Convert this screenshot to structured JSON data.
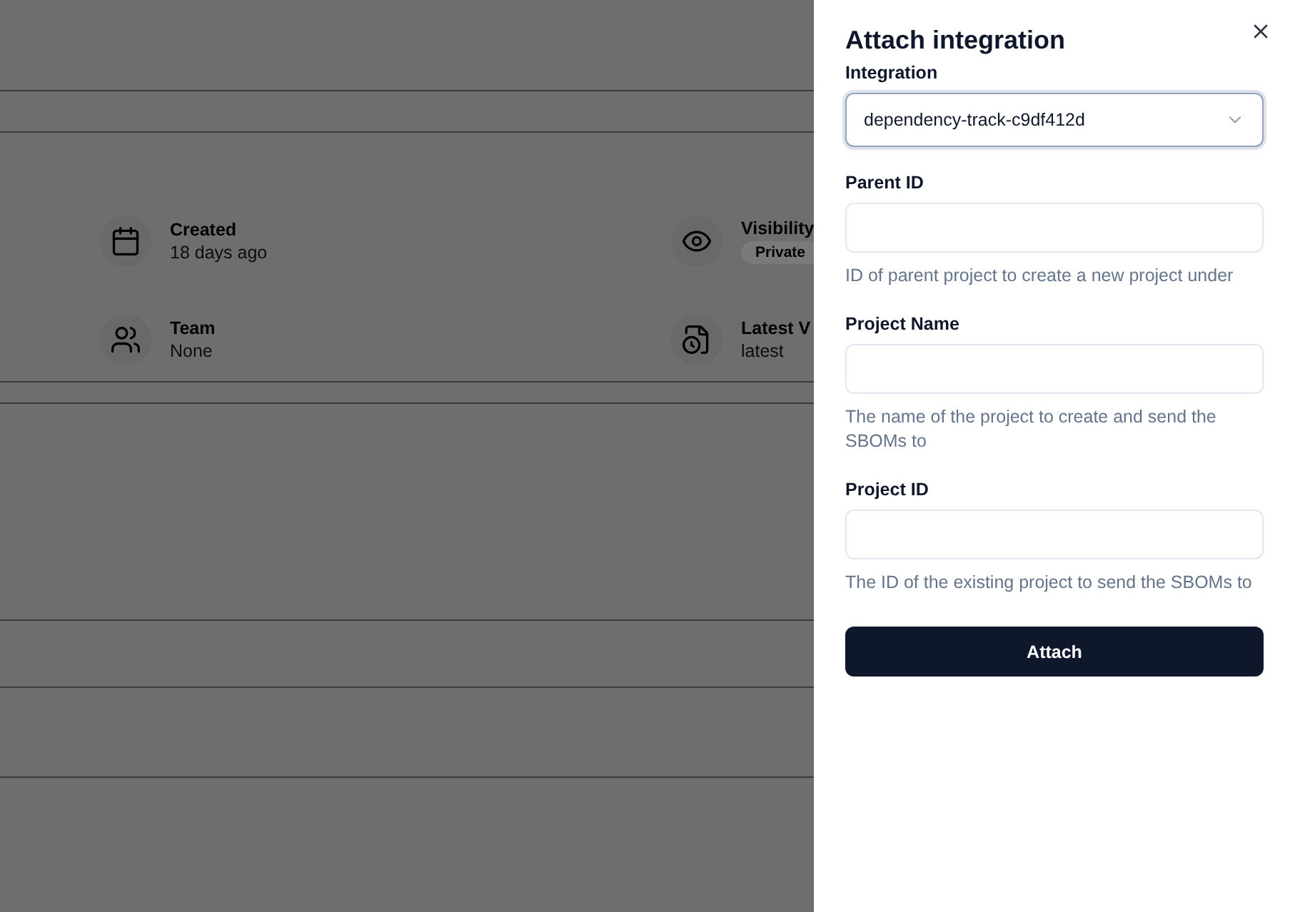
{
  "background": {
    "details": [
      {
        "label": "Created",
        "value": "18 days ago",
        "kind": "text"
      },
      {
        "label": "Visibility",
        "value": "Private",
        "kind": "badge"
      },
      {
        "label": "Team",
        "value": "None",
        "kind": "text"
      },
      {
        "label": "Latest V",
        "value": "latest",
        "kind": "text"
      }
    ]
  },
  "sheet": {
    "title": "Attach integration",
    "fields": [
      {
        "kind": "select",
        "label": "Integration",
        "value": "dependency-track-c9df412d",
        "focused": true
      },
      {
        "kind": "input",
        "label": "Parent ID",
        "help": "ID of parent project to create a new project under"
      },
      {
        "kind": "input",
        "label": "Project Name",
        "help": "The name of the project to create and send the SBOMs to"
      },
      {
        "kind": "input",
        "label": "Project ID",
        "help": "The ID of the existing project to send the SBOMs to"
      }
    ],
    "button": "Attach"
  }
}
